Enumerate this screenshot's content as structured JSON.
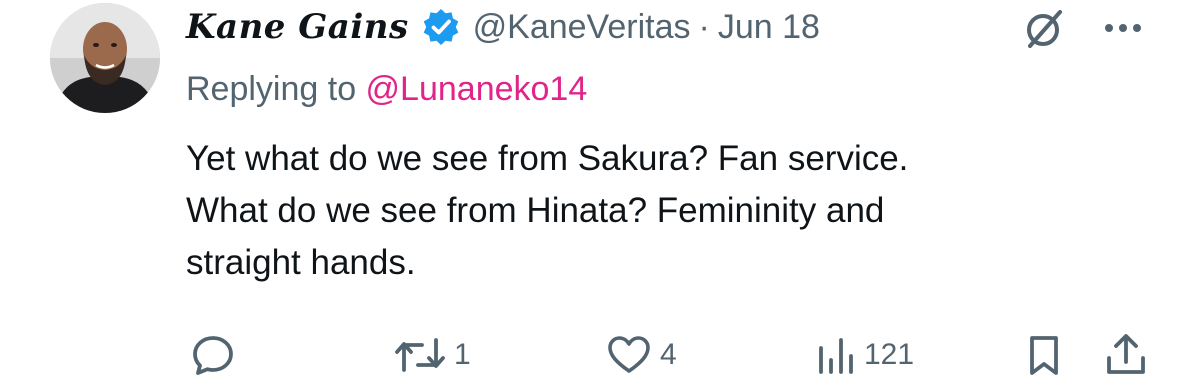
{
  "author": {
    "display_name": "Kane Gains",
    "handle": "@KaneVeritas",
    "separator": "·",
    "date": "Jun 18"
  },
  "reply": {
    "prefix": "Replying to ",
    "to_handle": "@Lunaneko14"
  },
  "body": {
    "lines": [
      "Yet what do we see from Sakura? Fan service.",
      "What do we see from Hinata? Femininity and",
      "straight hands."
    ]
  },
  "actions": {
    "reply_count": "",
    "retweet_count": "1",
    "like_count": "4",
    "views_count": "121"
  },
  "colors": {
    "verified_blue": "#1d9bf0",
    "reply_link_pink": "#e0248a",
    "secondary_gray": "#536471",
    "text_black": "#0f1419"
  },
  "icons": {
    "verified": "verified-badge-icon",
    "grok": "grok-icon",
    "more": "more-icon",
    "reply": "reply-icon",
    "retweet": "retweet-icon",
    "like": "heart-icon",
    "views": "views-icon",
    "bookmark": "bookmark-icon",
    "share": "share-icon"
  }
}
